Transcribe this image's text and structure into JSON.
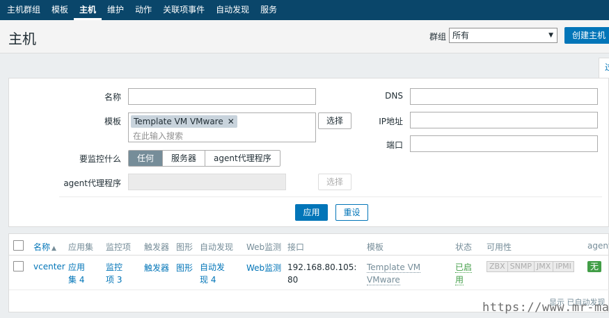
{
  "nav": {
    "items": [
      "主机群组",
      "模板",
      "主机",
      "维护",
      "动作",
      "关联项事件",
      "自动发现",
      "服务"
    ],
    "active_index": 2
  },
  "header": {
    "title": "主机",
    "group_label": "群组",
    "group_value": "所有",
    "create_button": "创建主机"
  },
  "filter_tab_label": "过",
  "filter": {
    "name_label": "名称",
    "name_value": "",
    "template_label": "模板",
    "template_tag": "Template VM VMware",
    "template_placeholder": "在此输入搜索",
    "select_button": "选择",
    "monitor_label": "要监控什么",
    "monitor_options": [
      "任何",
      "服务器",
      "agent代理程序"
    ],
    "monitor_selected_index": 0,
    "proxy_label": "agent代理程序",
    "proxy_select_button": "选择",
    "dns_label": "DNS",
    "dns_value": "",
    "ip_label": "IP地址",
    "ip_value": "",
    "port_label": "端口",
    "port_value": "",
    "apply_button": "应用",
    "reset_button": "重设"
  },
  "table": {
    "headers": {
      "name": "名称",
      "apps": "应用集",
      "items": "监控项",
      "triggers": "触发器",
      "graphs": "图形",
      "discovery": "自动发现",
      "web": "Web监测",
      "interface": "接口",
      "templates": "模板",
      "status": "状态",
      "availability": "可用性",
      "agent": "agent"
    },
    "rows": [
      {
        "name": "vcenter",
        "apps": "应用集 4",
        "items": "监控项 3",
        "triggers": "触发器",
        "graphs": "图形",
        "discovery": "自动发现 4",
        "web": "Web监测",
        "interface": "192.168.80.105: 80",
        "template": "Template VM VMware",
        "status": "已启用",
        "availability": [
          "ZBX",
          "SNMP",
          "JMX",
          "IPMI"
        ],
        "agent": "无"
      }
    ],
    "summary": "显示 已自动发现"
  },
  "watermark": "https://www.mr-mao.cn",
  "colors": {
    "nav_bg": "#0a466a",
    "primary": "#0275b8",
    "enabled_green": "#429e47",
    "muted_gray": "#768d99"
  }
}
